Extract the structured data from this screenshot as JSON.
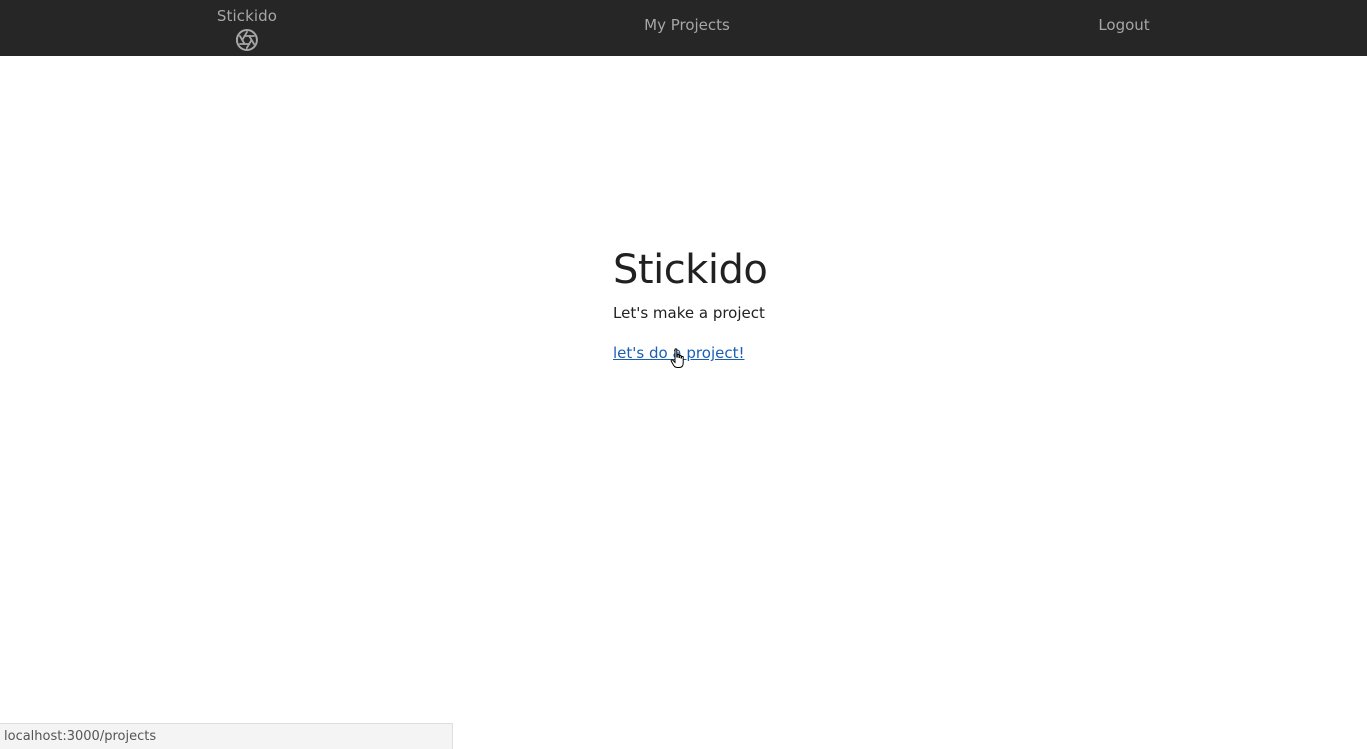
{
  "navbar": {
    "brand_label": "Stickido",
    "brand_icon": "aperture-icon",
    "links": {
      "projects": "My Projects",
      "logout": "Logout"
    },
    "background": "#262626",
    "text_color": "#a6a6a6"
  },
  "hero": {
    "title": "Stickido",
    "subtitle": "Let's make a project",
    "cta_link": "let's do a project!"
  },
  "statusbar": {
    "url": "localhost:3000/projects"
  },
  "colors": {
    "link": "#1a5fb4",
    "text": "#212121"
  }
}
